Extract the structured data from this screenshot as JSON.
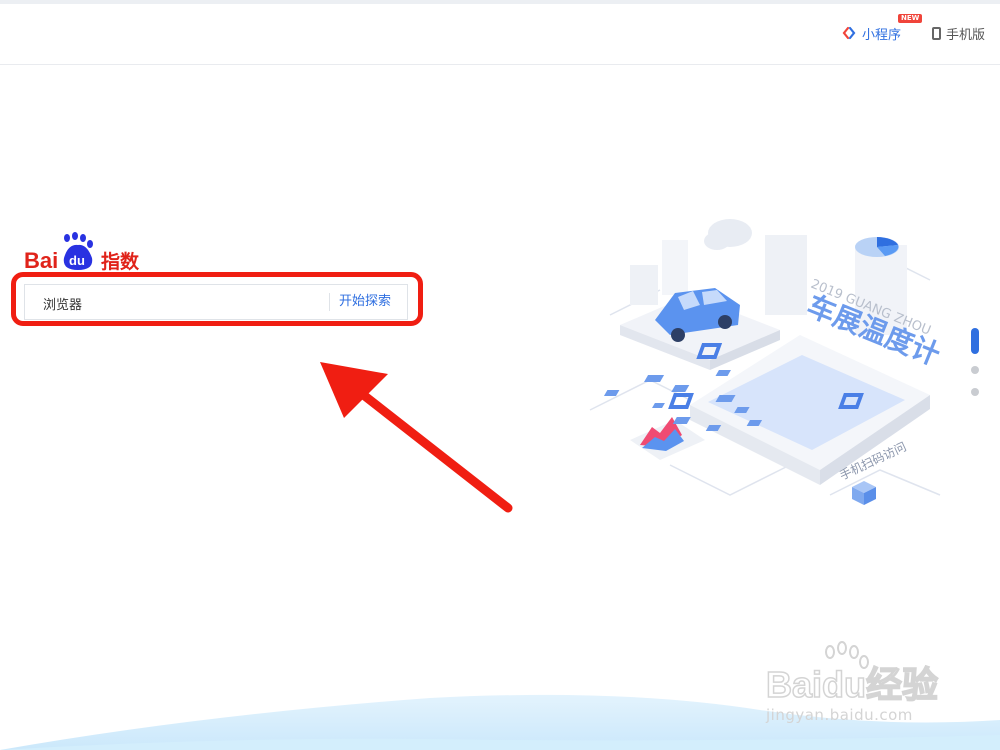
{
  "header": {
    "mini_program_label": "小程序",
    "new_badge": "NEW",
    "mobile_label": "手机版"
  },
  "logo": {
    "text_bai": "Bai",
    "text_du": "du",
    "text_zhishu": "指数"
  },
  "search": {
    "value": "浏览器",
    "button_label": "开始探索"
  },
  "illustration": {
    "year_label": "2019 GUANG ZHOU",
    "title": "车展温度计",
    "scan_hint": "手机扫码访问"
  },
  "carousel": {
    "active_index": 0,
    "count": 3
  },
  "watermark": {
    "brand": "Baidu经验",
    "url": "jingyan.baidu.com"
  },
  "colors": {
    "accent": "#2f6fe0",
    "highlight_red": "#f01e12",
    "logo_red": "#e0231a",
    "logo_blue": "#2932e1"
  }
}
